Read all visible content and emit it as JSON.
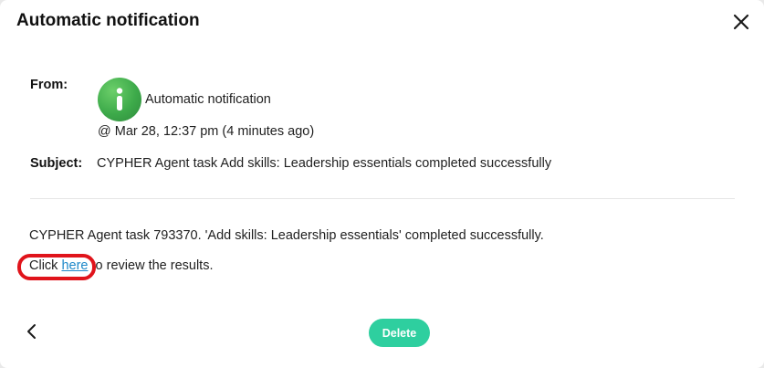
{
  "modal": {
    "title": "Automatic notification"
  },
  "message": {
    "from_label": "From:",
    "sender_name": "Automatic notification",
    "timestamp": "@ Mar 28, 12:37 pm (4 minutes ago)",
    "subject_label": "Subject:",
    "subject": "CYPHER Agent task Add skills: Leadership essentials completed successfully",
    "body_line": "CYPHER Agent task 793370. 'Add skills: Leadership essentials' completed successfully.",
    "click_prefix": "Click ",
    "link_text": "here",
    "click_suffix": " to review the results."
  },
  "footer": {
    "delete_label": "Delete"
  },
  "colors": {
    "link": "#1e88c9",
    "delete_button": "#2ecf9f",
    "avatar_green": "#3daa4a",
    "highlight_red": "#e0141b"
  },
  "icons": {
    "close": "close-icon",
    "info": "info-icon",
    "back": "chevron-left-icon"
  }
}
